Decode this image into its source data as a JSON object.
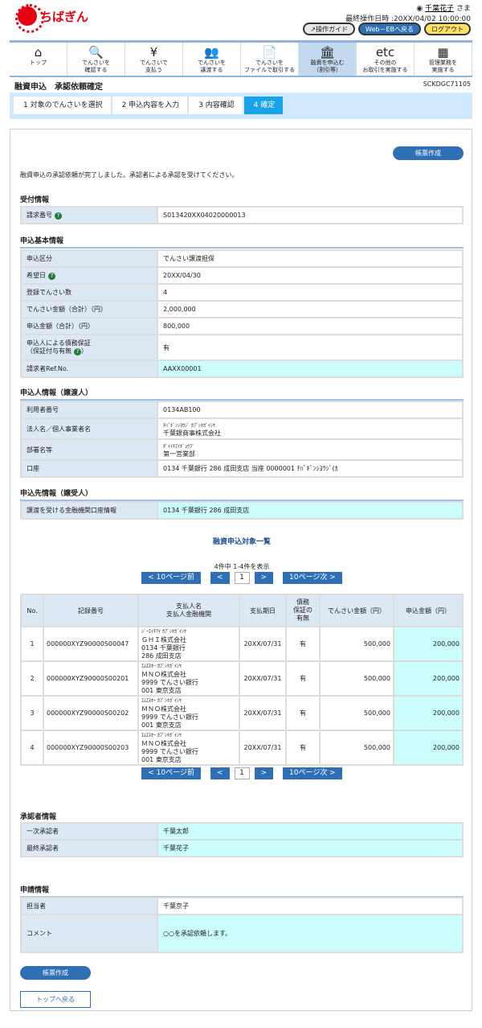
{
  "header": {
    "logo_text": "ちばぎん",
    "user_name": "千葉花子",
    "user_suffix": "さま",
    "last_op": "最終操作日時 :20XX/04/02 10:00:00",
    "guide": "操作ガイド",
    "web_eb": "Web－EBへ戻る",
    "logout": "ログアウト"
  },
  "nav": [
    {
      "icon": "home-icon",
      "glyph": "⌂",
      "label1": "トップ",
      "label2": ""
    },
    {
      "icon": "search-icon",
      "glyph": "🔍",
      "label1": "でんさいを",
      "label2": "確認する"
    },
    {
      "icon": "yen-icon",
      "glyph": "¥",
      "label1": "でんさいで",
      "label2": "支払う"
    },
    {
      "icon": "people-icon",
      "glyph": "👥",
      "label1": "でんさいを",
      "label2": "譲渡する"
    },
    {
      "icon": "file-icon",
      "glyph": "📄",
      "label1": "でんさいを",
      "label2": "ファイルで取引する"
    },
    {
      "icon": "bank-icon",
      "glyph": "🏛",
      "label1": "融資を申込む",
      "label2": "（割引等）"
    },
    {
      "icon": "etc-icon",
      "glyph": "etc",
      "label1": "その他の",
      "label2": "お取引を実施する"
    },
    {
      "icon": "admin-icon",
      "glyph": "▦",
      "label1": "管理業務を",
      "label2": "実施する"
    }
  ],
  "page": {
    "title": "融資申込　承認依頼確定",
    "code": "SCKDGC71105"
  },
  "steps": [
    "1 対象のでんさいを選択",
    "2 申込内容を入力",
    "3 内容確認",
    "4 確定"
  ],
  "report_button": "帳票作成",
  "message": "融資申込の承認依頼が完了しました。承認者による承認を受けてください。",
  "reception": {
    "title": "受付情報",
    "rows": [
      {
        "label": "請求番号",
        "value": "S013420XX04020000013"
      }
    ]
  },
  "basic": {
    "title": "申込基本情報",
    "rows": [
      {
        "label": "申込区分",
        "value": "でんさい譲渡担保"
      },
      {
        "label": "希望日",
        "value": "20XX/04/30"
      },
      {
        "label": "登録でんさい数",
        "value": "4"
      },
      {
        "label": "でんさい金額（合計）（円）",
        "value": "2,000,000"
      },
      {
        "label": "申込金額（合計）（円）",
        "value": "800,000"
      },
      {
        "label": "申込人による債務保証",
        "label2": "（保証付与有無",
        "label3": "）",
        "value": "有"
      },
      {
        "label": "請求者Ref.No.",
        "value": "AAXX00001"
      }
    ]
  },
  "applicant": {
    "title": "申込人情報（譲渡人）",
    "rows": [
      {
        "label": "利用者番号",
        "value": "0134AB100"
      },
      {
        "label": "法人名／個人事業者名",
        "kana": "ﾁﾊﾞｷﾞﾝｼﾖｳｼﾞ ｶﾌﾞｼｷｶﾞｲｼﾔ",
        "value": "千葉銀商事株式会社"
      },
      {
        "label": "部署名等",
        "kana": "ﾀﾞｲｲﾁｴｲｷﾞｮｳﾌﾞ",
        "value": "第一営業部"
      },
      {
        "label": "口座",
        "value": "0134 千葉銀行 286 成田支店 当座 0000001 ﾁﾊﾞｷﾞﾝｼﾖｳｼﾞ(ｶ"
      }
    ]
  },
  "destination": {
    "title": "申込先情報（譲受人）",
    "rows": [
      {
        "label": "譲渡を受ける金融機関口座情報",
        "value": "0134 千葉銀行 286 成田支店"
      }
    ]
  },
  "list": {
    "title": "融資申込対象一覧",
    "count_text": "4件中 1-4件を表示",
    "prev10": "< 10ページ前",
    "prev": "<",
    "page": "1",
    "next": ">",
    "next10": "10ページ次 >",
    "headers": [
      "No.",
      "記録番号",
      "支払人名\n支払人金融機関",
      "支払期日",
      "債務\n保証の\n有無",
      "でんさい金額（円）",
      "申込金額（円）"
    ],
    "rows": [
      {
        "no": "1",
        "rec": "000000XYZ90000S00047",
        "kana": "ｼﾞｰｴｲﾁｱｲ ｶﾌﾞｼｷｶﾞｲｼﾔ",
        "name": "ＧＨＩ株式会社",
        "bank": "0134 千葉銀行",
        "branch": "286 成田支店",
        "date": "20XX/07/31",
        "guar": "有",
        "amount": "500,000",
        "apply": "200,000"
      },
      {
        "no": "2",
        "rec": "000000XYZ90000S00201",
        "kana": "ｴﾑｴﾇｵｰ ｶﾌﾞｼｷｶﾞｲｼﾔ",
        "name": "ＭＮＯ株式会社",
        "bank": "9999 でんさい銀行",
        "branch": "001 東京支店",
        "date": "20XX/07/31",
        "guar": "有",
        "amount": "500,000",
        "apply": "200,000"
      },
      {
        "no": "3",
        "rec": "000000XYZ90000S00202",
        "kana": "ｴﾑｴﾇｵｰ ｶﾌﾞｼｷｶﾞｲｼﾔ",
        "name": "ＭＮＯ株式会社",
        "bank": "9999 でんさい銀行",
        "branch": "001 東京支店",
        "date": "20XX/07/31",
        "guar": "有",
        "amount": "500,000",
        "apply": "200,000"
      },
      {
        "no": "4",
        "rec": "000000XYZ90000S00203",
        "kana": "ｴﾑｴﾇｵｰ ｶﾌﾞｼｷｶﾞｲｼﾔ",
        "name": "ＭＮＯ株式会社",
        "bank": "9999 でんさい銀行",
        "branch": "001 東京支店",
        "date": "20XX/07/31",
        "guar": "有",
        "amount": "500,000",
        "apply": "200,000"
      }
    ]
  },
  "approver": {
    "title": "承認者情報",
    "rows": [
      {
        "label": "一次承認者",
        "value": "千葉太郎"
      },
      {
        "label": "最終承認者",
        "value": "千葉花子"
      }
    ]
  },
  "request": {
    "title": "申請情報",
    "rows": [
      {
        "label": "担当者",
        "value": "千葉京子"
      },
      {
        "label": "コメント",
        "value": "○○を承認依頼します。"
      }
    ]
  },
  "back_top": "トップへ戻る",
  "colors": {
    "brand": "#e60012",
    "button": "#2f6fb6",
    "highlight": "#cbfdfd",
    "label_bg": "#dce9f5"
  }
}
